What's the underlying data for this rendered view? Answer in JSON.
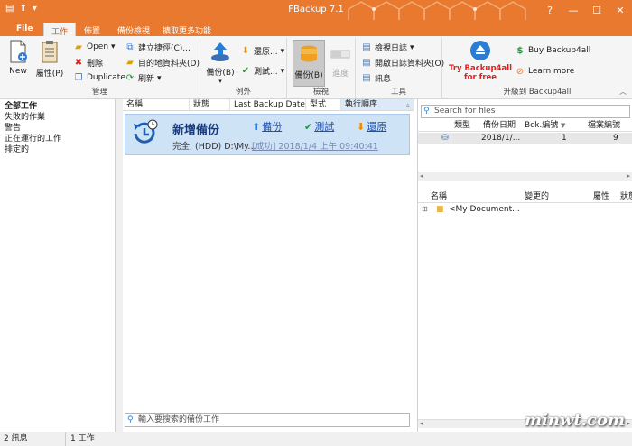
{
  "titlebar": {
    "title": "FBackup 7.1"
  },
  "tabs": [
    {
      "label": "File"
    },
    {
      "label": "工作"
    },
    {
      "label": "佈置"
    },
    {
      "label": "備份檢視"
    },
    {
      "label": "擴取更多功能"
    }
  ],
  "ribbon": {
    "manage": {
      "group_label": "管理",
      "new_label": "New",
      "props_label": "屬性(P)",
      "open_label": "Open",
      "delete_label": "刪除",
      "duplicate_label": "Duplicate",
      "create_shortcut_label": "建立捷徑(C)...",
      "dest_folder_label": "目的地資料夾(D)",
      "refresh_label": "刷新"
    },
    "exceptions": {
      "group_label": "例外",
      "backup_label": "備份(B)",
      "restore_label": "還原...",
      "test_label": "測試..."
    },
    "view": {
      "group_label": "檢視",
      "backup_view_label": "備份(B)",
      "progress_label": "進度"
    },
    "tools": {
      "group_label": "工具",
      "view_log_label": "檢視日誌",
      "open_log_folder_label": "開啟日誌資料夾(O)",
      "messages_label": "訊息"
    },
    "upgrade": {
      "group_label": "升級到 Backup4all",
      "try_line1": "Try Backup4all",
      "try_line2": "for free",
      "buy_label": "Buy Backup4all",
      "learn_label": "Learn more"
    }
  },
  "left_nav": [
    "全部工作",
    "失敗的作業",
    "警告",
    "正在運行的工作",
    "排定的"
  ],
  "job_list": {
    "columns": [
      "名稱",
      "狀態",
      "Last Backup Date",
      "型式",
      "執行順序"
    ],
    "job": {
      "name": "新增備份",
      "backup_link": "備份",
      "test_link": "測試",
      "restore_link": "還原",
      "status_line": "完全, (HDD) D:\\My...",
      "last_result": "[成功] 2018/1/4 上午 09:40:41"
    },
    "search_placeholder": "輸入要搜索的備份工作"
  },
  "right_pane": {
    "search_placeholder": "Search for files",
    "backups_columns": [
      "類型",
      "備份日期",
      "Bck.編號",
      "檔案編號"
    ],
    "backups_row": {
      "date": "2018/1/...",
      "bck_no": "1",
      "file_no": "9"
    },
    "files_columns": [
      "名稱",
      "變更的",
      "屬性",
      "狀態"
    ],
    "files_row": {
      "name": "<My Document..."
    }
  },
  "statusbar": {
    "messages": "2 訊息",
    "jobs": "1 工作"
  },
  "watermark": "minwt.com",
  "colors": {
    "accent": "#e8792f",
    "selection": "#cfe3f7",
    "link": "#1a4fb3"
  }
}
